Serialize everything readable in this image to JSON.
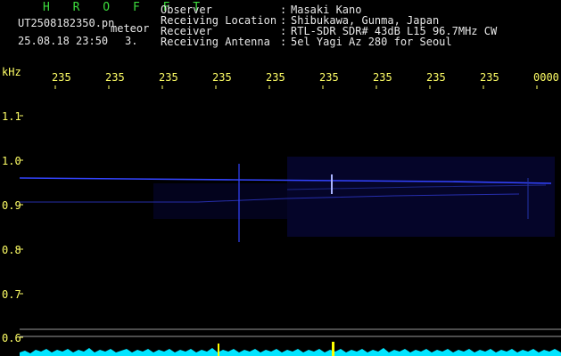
{
  "header": {
    "title": "H R O F F T",
    "filename": "UT2508182350.pn",
    "meteor_label": "meteor",
    "timestamp": "25.08.18 23:50",
    "count": "3."
  },
  "info": [
    {
      "label": "Observer",
      "sep": ":",
      "value": "Masaki Kano"
    },
    {
      "label": "Receiving Location",
      "sep": ":",
      "value": "Shibukawa, Gunma, Japan"
    },
    {
      "label": "Receiver",
      "sep": ":",
      "value": "RTL-SDR SDR# 43dB L15 96.7MHz CW"
    },
    {
      "label": "Receiving Antenna",
      "sep": ":",
      "value": "5el Yagi Az 280 for Seoul"
    }
  ],
  "y_axis": {
    "unit": "kHz",
    "ticks": [
      "1.1",
      "1.0",
      "0.9",
      "0.8",
      "0.7",
      "0.6"
    ]
  },
  "x_axis": {
    "ticks": [
      "235",
      "235",
      "235",
      "235",
      "235",
      "235",
      "235",
      "235",
      "235",
      "0000"
    ]
  },
  "colors": {
    "background": "#000000",
    "header_green": "#3ddc3d",
    "tick_yellow": "#ffff66",
    "trace_blue": "#3344ff",
    "spectrum_cyan": "#00e5ff",
    "marker_yellow": "#ffff00"
  }
}
